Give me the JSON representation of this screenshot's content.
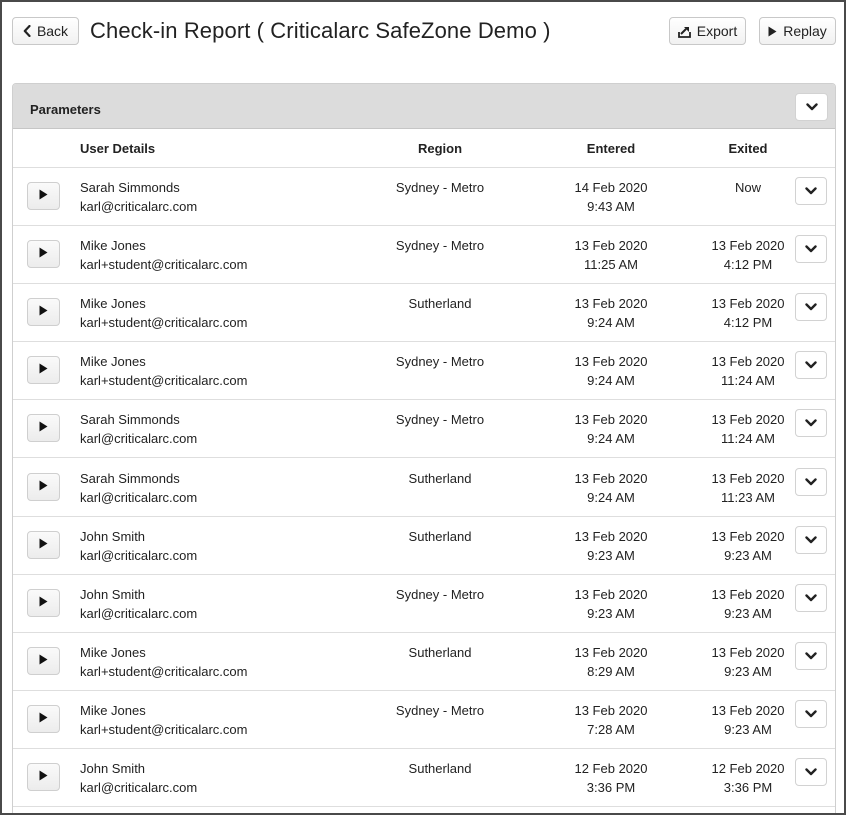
{
  "header": {
    "back_label": "Back",
    "title": "Check-in Report ( Criticalarc SafeZone Demo )",
    "export_label": "Export",
    "replay_label": "Replay"
  },
  "parameters": {
    "title": "Parameters"
  },
  "table": {
    "columns": [
      "User Details",
      "Region",
      "Entered",
      "Exited"
    ],
    "rows": [
      {
        "name": "Sarah Simmonds",
        "email": "karl@criticalarc.com",
        "region": "Sydney - Metro",
        "entered_date": "14 Feb 2020",
        "entered_time": "9:43 AM",
        "exited_date": "Now",
        "exited_time": ""
      },
      {
        "name": "Mike Jones",
        "email": "karl+student@criticalarc.com",
        "region": "Sydney - Metro",
        "entered_date": "13 Feb 2020",
        "entered_time": "11:25 AM",
        "exited_date": "13 Feb 2020",
        "exited_time": "4:12 PM"
      },
      {
        "name": "Mike Jones",
        "email": "karl+student@criticalarc.com",
        "region": "Sutherland",
        "entered_date": "13 Feb 2020",
        "entered_time": "9:24 AM",
        "exited_date": "13 Feb 2020",
        "exited_time": "4:12 PM"
      },
      {
        "name": "Mike Jones",
        "email": "karl+student@criticalarc.com",
        "region": "Sydney - Metro",
        "entered_date": "13 Feb 2020",
        "entered_time": "9:24 AM",
        "exited_date": "13 Feb 2020",
        "exited_time": "11:24 AM"
      },
      {
        "name": "Sarah Simmonds",
        "email": "karl@criticalarc.com",
        "region": "Sydney - Metro",
        "entered_date": "13 Feb 2020",
        "entered_time": "9:24 AM",
        "exited_date": "13 Feb 2020",
        "exited_time": "11:24 AM"
      },
      {
        "name": "Sarah Simmonds",
        "email": "karl@criticalarc.com",
        "region": "Sutherland",
        "entered_date": "13 Feb 2020",
        "entered_time": "9:24 AM",
        "exited_date": "13 Feb 2020",
        "exited_time": "11:23 AM"
      },
      {
        "name": "John Smith",
        "email": "karl@criticalarc.com",
        "region": "Sutherland",
        "entered_date": "13 Feb 2020",
        "entered_time": "9:23 AM",
        "exited_date": "13 Feb 2020",
        "exited_time": "9:23 AM"
      },
      {
        "name": "John Smith",
        "email": "karl@criticalarc.com",
        "region": "Sydney - Metro",
        "entered_date": "13 Feb 2020",
        "entered_time": "9:23 AM",
        "exited_date": "13 Feb 2020",
        "exited_time": "9:23 AM"
      },
      {
        "name": "Mike Jones",
        "email": "karl+student@criticalarc.com",
        "region": "Sutherland",
        "entered_date": "13 Feb 2020",
        "entered_time": "8:29 AM",
        "exited_date": "13 Feb 2020",
        "exited_time": "9:23 AM"
      },
      {
        "name": "Mike Jones",
        "email": "karl+student@criticalarc.com",
        "region": "Sydney - Metro",
        "entered_date": "13 Feb 2020",
        "entered_time": "7:28 AM",
        "exited_date": "13 Feb 2020",
        "exited_time": "9:23 AM"
      },
      {
        "name": "John Smith",
        "email": "karl@criticalarc.com",
        "region": "Sutherland",
        "entered_date": "12 Feb 2020",
        "entered_time": "3:36 PM",
        "exited_date": "12 Feb 2020",
        "exited_time": "3:36 PM"
      }
    ]
  },
  "icons": {
    "back": "chevron-left-icon",
    "export": "export-icon",
    "replay": "play-icon",
    "toggle": "chevron-down-icon",
    "row_play": "play-icon"
  }
}
